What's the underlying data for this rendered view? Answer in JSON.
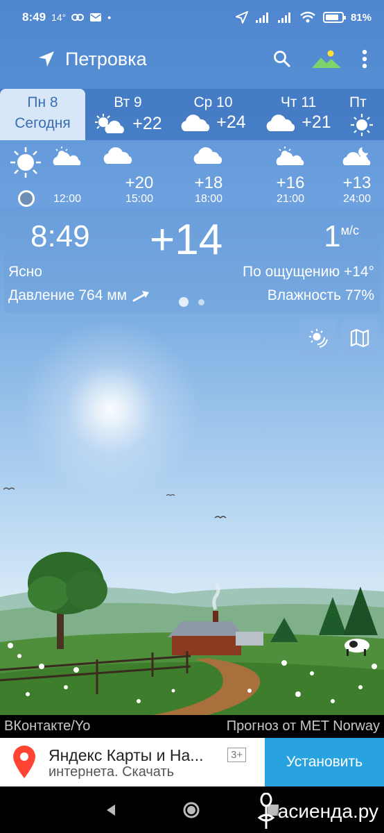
{
  "status_bar": {
    "time": "8:49",
    "temp": "14°",
    "battery": "81"
  },
  "toolbar": {
    "location": "Петровка"
  },
  "days": [
    {
      "name": "Пн 8",
      "sub": "Сегодня",
      "temp": ""
    },
    {
      "name": "Вт 9",
      "sub": "",
      "temp": "+22",
      "icon": "partly-cloudy-icon"
    },
    {
      "name": "Ср 10",
      "sub": "",
      "temp": "+24",
      "icon": "cloud-icon"
    },
    {
      "name": "Чт 11",
      "sub": "",
      "temp": "+21",
      "icon": "cloud-icon"
    },
    {
      "name": "Пт",
      "sub": "",
      "temp": "",
      "icon": "sun-icon"
    }
  ],
  "hourly": [
    {
      "time": "",
      "temp": "",
      "icon": "sun-icon"
    },
    {
      "time": "12:00",
      "temp": "",
      "icon": "partly-cloudy-icon"
    },
    {
      "time": "15:00",
      "temp": "+20",
      "icon": "cloud-icon"
    },
    {
      "time": "18:00",
      "temp": "+18",
      "icon": "cloud-icon"
    },
    {
      "time": "21:00",
      "temp": "+16",
      "icon": "partly-cloudy-icon"
    },
    {
      "time": "24:00",
      "temp": "+13",
      "icon": "cloud-moon-icon"
    }
  ],
  "current": {
    "time": "8:49",
    "temperature": "+14",
    "wind_speed": "1",
    "wind_unit": "м/с",
    "condition": "Ясно",
    "feels_like": "По ощущению +14°",
    "pressure": "Давление 764 мм",
    "humidity": "Влажность 77%"
  },
  "footer": {
    "left": "ВКонтакте/Yo",
    "right": "Прогноз от MET Norway"
  },
  "ad": {
    "title": "Яндекс Карты и На...",
    "subtitle": "интернета. Скачать",
    "age": "3+",
    "button": "Установить"
  },
  "watermark": "асиенда.ру"
}
